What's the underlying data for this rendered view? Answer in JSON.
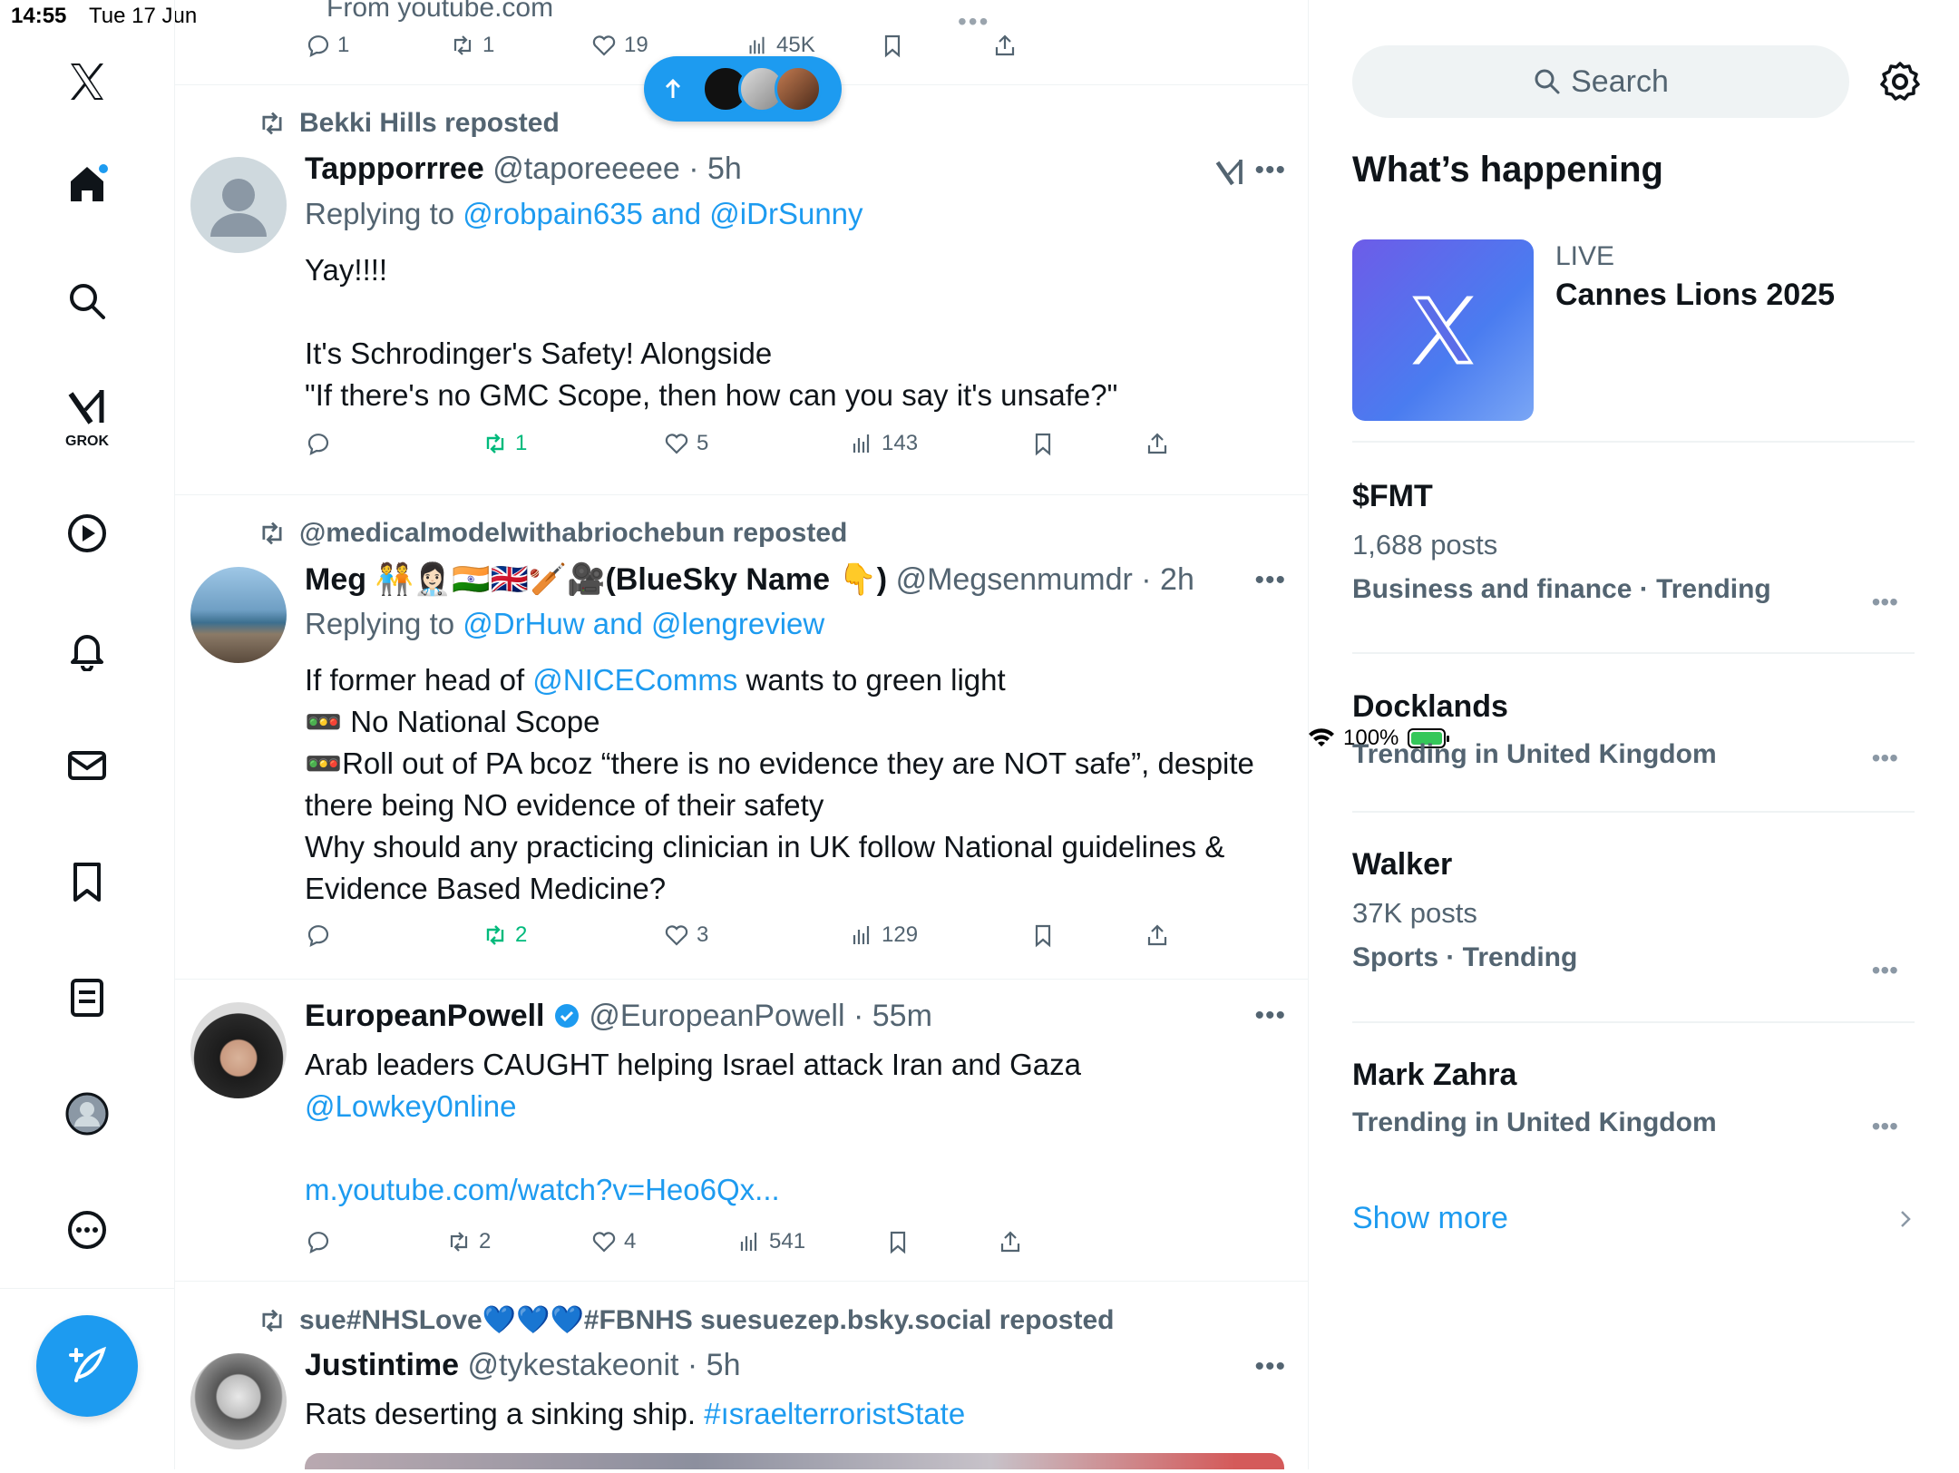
{
  "status_bar": {
    "time": "14:55",
    "date": "Tue 17 Jun",
    "battery": "100%"
  },
  "nav": {
    "grok_label": "GROK"
  },
  "pill": {
    "icon": "arrow-up-icon"
  },
  "top_partial": {
    "text": "From youtube.com",
    "replies": "1",
    "reposts": "1",
    "likes": "19",
    "views": "45K"
  },
  "tweets": [
    {
      "repost_by": "Bekki Hills reposted",
      "name": "Tappporrree",
      "handle": "@taporeeeee",
      "time": "· 5h",
      "reply_prefix": "Replying to ",
      "reply_to": "@robpain635 and @iDrSunny",
      "text_line1": "Yay!!!!",
      "text_line2": "It's Schrodinger's Safety! Alongside",
      "text_line3": "\"If there's no GMC Scope, then how can you say it's unsafe?\"",
      "replies": "",
      "reposts": "1",
      "likes": "5",
      "views": "143"
    },
    {
      "repost_by": "@medicalmodelwithabriochebun reposted",
      "name": "Meg 🧑‍🤝‍🧑👩🏻‍⚕️🇮🇳🇬🇧🏏🎥(BlueSky Name 👇)",
      "handle": "@Megsenmumdr",
      "time": "· 2h",
      "reply_prefix": "Replying to ",
      "reply_to": "@DrHuw and @lengreview",
      "text_a": "If former head of ",
      "text_mention": "@NICEComms",
      "text_b": " wants to green light",
      "text_line2": "🚥 No National Scope",
      "text_line3": "🚥Roll out of PA bcoz “there is no evidence they are NOT safe”, despite there being NO evidence of their safety",
      "text_line4": "Why should any practicing clinician in UK follow National guidelines & Evidence Based Medicine?",
      "replies": "",
      "reposts": "2",
      "likes": "3",
      "views": "129"
    },
    {
      "name": "EuropeanPowell",
      "handle": "@EuropeanPowell",
      "time": "· 55m",
      "text_line1": "Arab leaders CAUGHT helping Israel attack Iran and Gaza",
      "mention": "@Lowkey0nline",
      "url": "m.youtube.com/watch?v=Heo6Qx...",
      "replies": "",
      "reposts": "2",
      "likes": "4",
      "views": "541"
    },
    {
      "repost_by": "sue#NHSLove💙💙💙#FBNHS suesuezep.bsky.social reposted",
      "name": "Justintime",
      "handle": "@tykestakeonit",
      "time": "· 5h",
      "text_a": "Rats deserting a sinking ship. ",
      "hashtag": "#ısraelterroristState"
    }
  ],
  "right": {
    "search_placeholder": "Search",
    "section_title": "What’s happening",
    "live": {
      "label": "LIVE",
      "title": "Cannes Lions 2025"
    },
    "trends": [
      {
        "title": "$FMT",
        "posts": "1,688 posts",
        "category": "Business and finance · Trending"
      },
      {
        "title": "Docklands",
        "posts": "",
        "category": "Trending in United Kingdom"
      },
      {
        "title": "Walker",
        "posts": "37K posts",
        "category": "Sports · Trending"
      },
      {
        "title": "Mark Zahra",
        "posts": "",
        "category": "Trending in United Kingdom"
      }
    ],
    "show_more": "Show more"
  },
  "colors": {
    "accent": "#1d9bf0",
    "repost_active": "#00ba7c",
    "muted": "#536471"
  }
}
